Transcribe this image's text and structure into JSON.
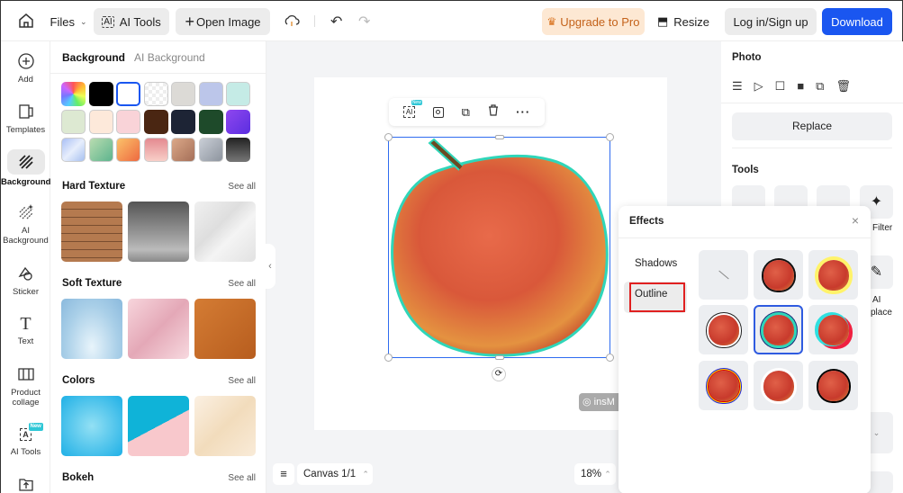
{
  "topbar": {
    "files_label": "Files",
    "ai_tools_label": "AI Tools",
    "open_image_label": "Open Image",
    "upgrade_label": "Upgrade to Pro",
    "resize_label": "Resize",
    "login_label": "Log in/Sign up",
    "download_label": "Download"
  },
  "sidebar": {
    "items": [
      {
        "label": "Add",
        "icon": "plus-circle-icon"
      },
      {
        "label": "Templates",
        "icon": "templates-icon"
      },
      {
        "label": "Background",
        "icon": "background-icon"
      },
      {
        "label": "AI Background",
        "icon": "ai-background-icon"
      },
      {
        "label": "Sticker",
        "icon": "sticker-icon"
      },
      {
        "label": "Text",
        "icon": "text-icon"
      },
      {
        "label": "Product collage",
        "icon": "collage-icon"
      },
      {
        "label": "AI Tools",
        "icon": "ai-tools-icon",
        "badge": "New"
      },
      {
        "label": "",
        "icon": "upload-icon"
      }
    ]
  },
  "panel": {
    "tabs": [
      "Background",
      "AI Background"
    ],
    "swatch_colors": [
      "rainbow",
      "#000000",
      "#ffffff",
      "transparent",
      "#dcdad6",
      "#bcc6ea",
      "#c5ebe6",
      "#dde9d2",
      "#fde9da",
      "#f9d3d8",
      "#4a2612",
      "#1d2435",
      "#1e4a2a",
      "#7c3fe8",
      "grad-blue",
      "grad-green",
      "grad-orange",
      "grad-pink",
      "grad-brown",
      "grad-silver",
      "grad-dark"
    ],
    "sections": [
      {
        "title": "Hard Texture",
        "see_all": "See all"
      },
      {
        "title": "Soft Texture",
        "see_all": "See all"
      },
      {
        "title": "Colors",
        "see_all": "See all"
      },
      {
        "title": "Bokeh",
        "see_all": "See all"
      }
    ]
  },
  "canvas": {
    "toolbar_badge": "New",
    "watermark": "insM",
    "canvas_label": "Canvas 1/1",
    "zoom": "18%"
  },
  "right_panel": {
    "photo_title": "Photo",
    "replace_label": "Replace",
    "tools_title": "Tools",
    "filter_label": "Filter",
    "ai_replace_label_1": "AI",
    "ai_replace_label_2": "place"
  },
  "effects": {
    "title": "Effects",
    "tabs": [
      "Shadows",
      "Outline"
    ],
    "selected_tab": "Outline",
    "selected_index": 4
  }
}
